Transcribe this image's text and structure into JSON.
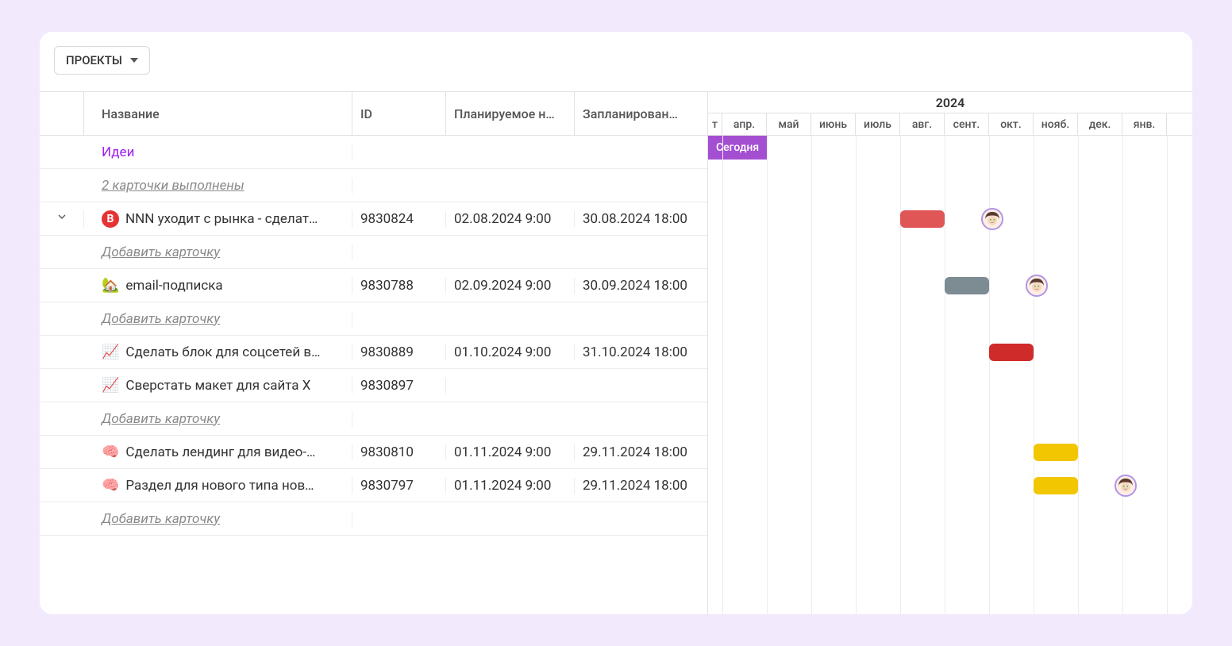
{
  "dropdown": {
    "label": "ПРОЕКТЫ"
  },
  "columns": {
    "name": "Название",
    "id": "ID",
    "start": "Планируемое н…",
    "end": "Запланирован…"
  },
  "group": {
    "title": "Идеи",
    "done_link": "2 карточки выполнены",
    "add_card": "Добавить карточку"
  },
  "timeline": {
    "year": "2024",
    "months_partial": "т",
    "months": [
      "апр.",
      "май",
      "июнь",
      "июль",
      "авг.",
      "сент.",
      "окт.",
      "нояб.",
      "дек.",
      "янв."
    ],
    "today_label": "Сегодня"
  },
  "rows": [
    {
      "type": "group_title"
    },
    {
      "type": "done_link"
    },
    {
      "type": "task",
      "icon": "B",
      "icon_type": "badge",
      "name": "NNN уходит с рынка - сделат…",
      "id": "9830824",
      "start": "02.08.2024 9:00",
      "end": "30.08.2024 18:00",
      "bar": {
        "color": "red",
        "month_start": 5,
        "month_end": 6,
        "avatar_month": 7
      },
      "toggle": true
    },
    {
      "type": "add_link"
    },
    {
      "type": "task",
      "icon": "🏡",
      "icon_type": "emoji",
      "name": "email-подписка",
      "id": "9830788",
      "start": "02.09.2024 9:00",
      "end": "30.09.2024 18:00",
      "bar": {
        "color": "gray",
        "month_start": 6,
        "month_end": 7,
        "avatar_month": 8
      }
    },
    {
      "type": "add_link"
    },
    {
      "type": "task",
      "icon": "📈",
      "icon_type": "emoji",
      "name": "Сделать блок для соцсетей в…",
      "id": "9830889",
      "start": "01.10.2024 9:00",
      "end": "31.10.2024 18:00",
      "bar": {
        "color": "darkred",
        "month_start": 7,
        "month_end": 8
      }
    },
    {
      "type": "task",
      "icon": "📈",
      "icon_type": "emoji",
      "name": "Сверстать макет для сайта Х",
      "id": "9830897",
      "start": "",
      "end": ""
    },
    {
      "type": "add_link"
    },
    {
      "type": "task",
      "icon": "🧠",
      "icon_type": "emoji",
      "name": "Сделать лендинг для видео-…",
      "id": "9830810",
      "start": "01.11.2024 9:00",
      "end": "29.11.2024 18:00",
      "bar": {
        "color": "yellow",
        "month_start": 8,
        "month_end": 9
      }
    },
    {
      "type": "task",
      "icon": "🧠",
      "icon_type": "emoji",
      "name": "Раздел для нового типа нов…",
      "id": "9830797",
      "start": "01.11.2024 9:00",
      "end": "29.11.2024 18:00",
      "bar": {
        "color": "yellow",
        "month_start": 8,
        "month_end": 9,
        "avatar_month": 10
      }
    },
    {
      "type": "add_link"
    }
  ]
}
